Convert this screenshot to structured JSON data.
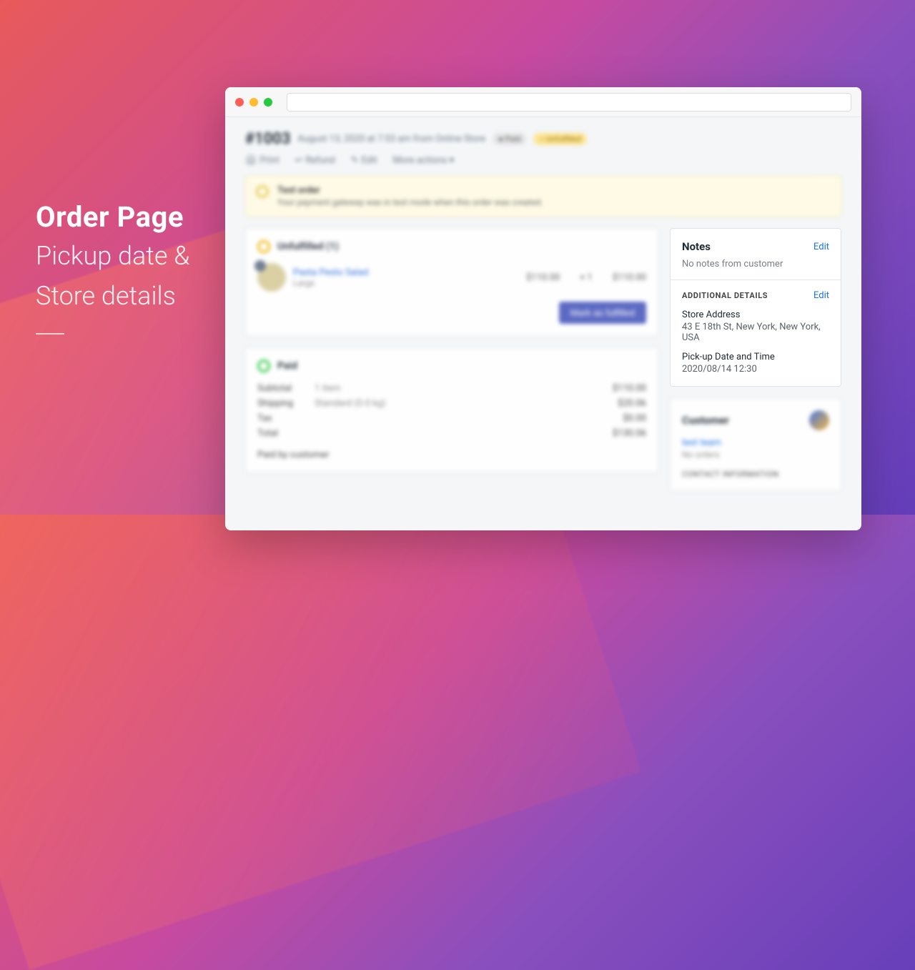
{
  "marketing": {
    "title": "Order Page",
    "line1": "Pickup date &",
    "line2": "Store details"
  },
  "header": {
    "order_id": "#1003",
    "meta": "August 13, 2020 at 7:53 am from Online Store",
    "badge_paid": "● Paid",
    "badge_unfulfilled": "○ Unfulfilled"
  },
  "actions": {
    "print": "Print",
    "refund": "Refund",
    "edit": "Edit",
    "more": "More actions ▾"
  },
  "banner": {
    "title": "Test order",
    "text": "Your payment gateway was in test mode when this order was created."
  },
  "fulfillment": {
    "title": "Unfulfilled (1)",
    "item_name": "Pasta Pesto Salad",
    "variant": "Large",
    "unit_price": "$110.00",
    "qty": "× 1",
    "line_total": "$110.00",
    "button": "Mark as fulfilled"
  },
  "paid": {
    "title": "Paid",
    "rows": [
      {
        "label": "Subtotal",
        "mid": "1 item",
        "val": "$110.00"
      },
      {
        "label": "Shipping",
        "mid": "Standard (0.0 kg)",
        "val": "$20.06"
      },
      {
        "label": "Tax",
        "mid": "",
        "val": "$0.00"
      },
      {
        "label": "Total",
        "mid": "",
        "val": "$130.06"
      }
    ],
    "paid_by": "Paid by customer"
  },
  "notes": {
    "title": "Notes",
    "edit": "Edit",
    "body": "No notes from customer",
    "addl_title": "ADDITIONAL DETAILS",
    "addl_edit": "Edit",
    "store_label": "Store Address",
    "store_value": "43 E 18th St, New York, New York, USA",
    "pickup_label": "Pick-up Date and Time",
    "pickup_value": "2020/08/14 12:30"
  },
  "customer": {
    "title": "Customer",
    "name": "test team",
    "orders": "No orders",
    "contact": "CONTACT INFORMATION"
  }
}
